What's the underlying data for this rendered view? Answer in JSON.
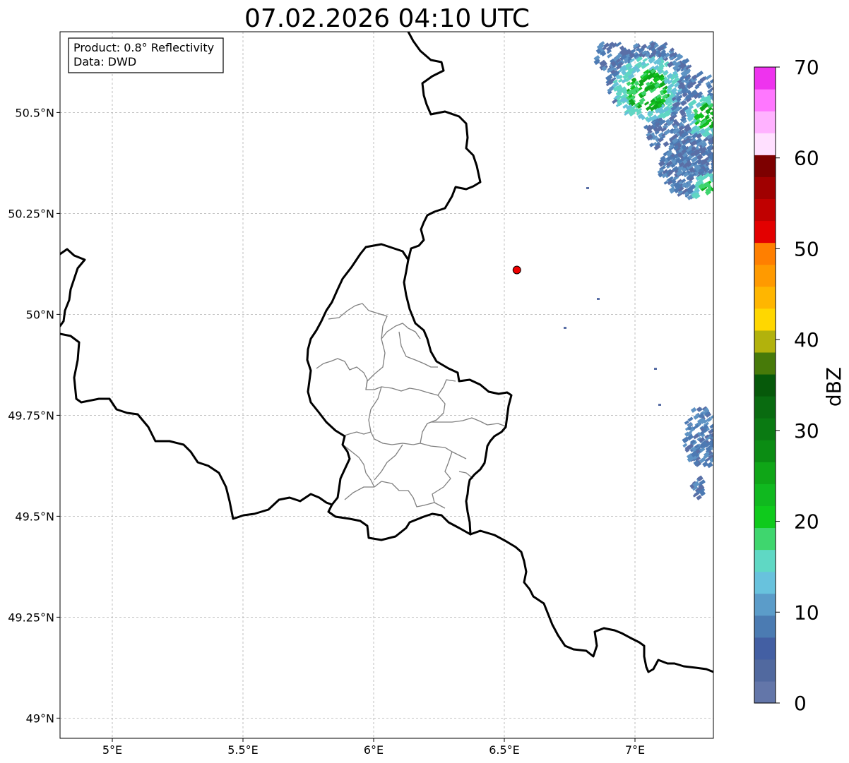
{
  "title": "07.02.2026 04:10 UTC",
  "info": {
    "product": "Product: 0.8° Reflectivity",
    "source": "Data: DWD"
  },
  "map": {
    "lon_range": [
      4.8,
      7.3
    ],
    "lat_range": [
      48.95,
      50.7
    ],
    "x_ticks": [
      {
        "value": 5.0,
        "label": "5°E"
      },
      {
        "value": 5.5,
        "label": "5.5°E"
      },
      {
        "value": 6.0,
        "label": "6°E"
      },
      {
        "value": 6.5,
        "label": "6.5°E"
      },
      {
        "value": 7.0,
        "label": "7°E"
      }
    ],
    "y_ticks": [
      {
        "value": 50.5,
        "label": "50.5°N"
      },
      {
        "value": 50.25,
        "label": "50.25°N"
      },
      {
        "value": 50.0,
        "label": "50°N"
      },
      {
        "value": 49.75,
        "label": "49.75°N"
      },
      {
        "value": 49.5,
        "label": "49.5°N"
      },
      {
        "value": 49.25,
        "label": "49.25°N"
      },
      {
        "value": 49.0,
        "label": "49°N"
      }
    ],
    "marker": {
      "lon": 6.548,
      "lat": 50.11,
      "color": "#ee0000"
    },
    "echo_colors": [
      "#5a6fa6",
      "#4d7ab3",
      "#5e93c4",
      "#66c1d9",
      "#5fd6c3",
      "#3fd46e",
      "#10c21f",
      "#0ea81a"
    ]
  },
  "colorbar": {
    "label": "dBZ",
    "vmin": 0,
    "vmax": 70,
    "ticks": [
      {
        "value": 0,
        "label": "0"
      },
      {
        "value": 10,
        "label": "10"
      },
      {
        "value": 20,
        "label": "20"
      },
      {
        "value": 30,
        "label": "30"
      },
      {
        "value": 40,
        "label": "40"
      },
      {
        "value": 50,
        "label": "50"
      },
      {
        "value": 60,
        "label": "60"
      },
      {
        "value": 70,
        "label": "70"
      }
    ],
    "colors": [
      "#6376a9",
      "#51699f",
      "#435fa3",
      "#4b7bb2",
      "#5b9cc9",
      "#68c2dd",
      "#5fd8c4",
      "#3fd66e",
      "#0fca1c",
      "#10b91f",
      "#0fa617",
      "#0b8c13",
      "#0a7a12",
      "#096b10",
      "#06590a",
      "#477a09",
      "#b2b20c",
      "#ffd700",
      "#ffb600",
      "#ff9a00",
      "#ff7f00",
      "#e30000",
      "#c00000",
      "#a00000",
      "#7d0000",
      "#ffe0ff",
      "#ffb2ff",
      "#ff77ff",
      "#ee33ee"
    ]
  }
}
